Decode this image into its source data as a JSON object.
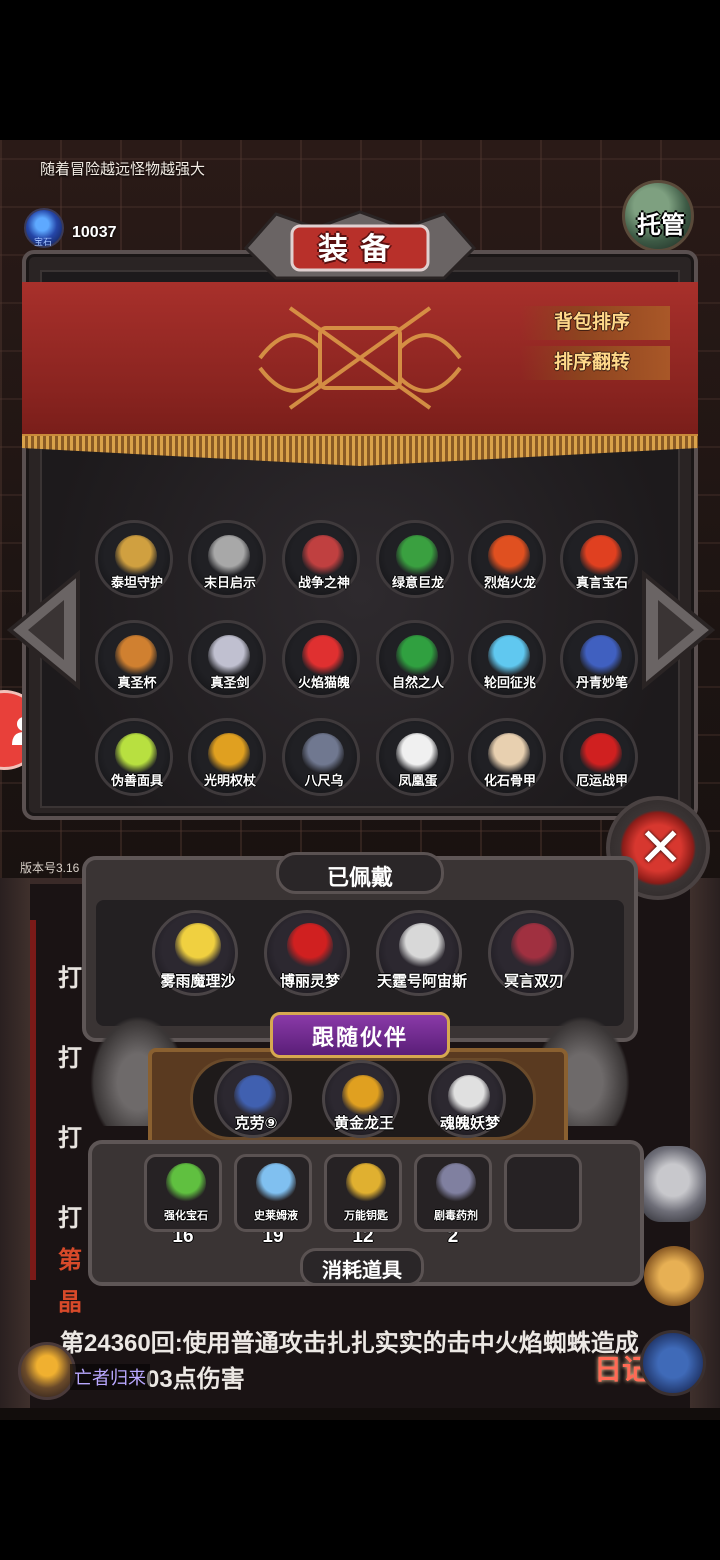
{
  "hint": "随着冒险越远怪物越强大",
  "currency": {
    "label": "宝石",
    "count": "10037",
    "icon": "gem-icon"
  },
  "auto_button": "托管",
  "version": "版本号3.16",
  "equipment": {
    "title": "装备",
    "sort_label": "背包排序",
    "reverse_label": "排序翻转",
    "items": [
      {
        "name": "泰坦守护",
        "color": "#d0a040"
      },
      {
        "name": "末日启示",
        "color": "#a8a8a8"
      },
      {
        "name": "战争之神",
        "color": "#c04040"
      },
      {
        "name": "绿意巨龙",
        "color": "#3aa040"
      },
      {
        "name": "烈焰火龙",
        "color": "#e05020"
      },
      {
        "name": "真言宝石",
        "color": "#e04020"
      },
      {
        "name": "真圣杯",
        "color": "#d08030"
      },
      {
        "name": "真圣剑",
        "color": "#c0c0d0"
      },
      {
        "name": "火焰猫魄",
        "color": "#e03030"
      },
      {
        "name": "自然之人",
        "color": "#30a040"
      },
      {
        "name": "轮回征兆",
        "color": "#60c8f0"
      },
      {
        "name": "丹青妙笔",
        "color": "#4060c0"
      },
      {
        "name": "伪善面具",
        "color": "#b8e040"
      },
      {
        "name": "光明权杖",
        "color": "#e0a020"
      },
      {
        "name": "八尺乌",
        "color": "#707890"
      },
      {
        "name": "凤凰蛋",
        "color": "#f0f0f0"
      },
      {
        "name": "化石骨甲",
        "color": "#e8d0b0"
      },
      {
        "name": "厄运战甲",
        "color": "#d02020"
      }
    ]
  },
  "worn": {
    "title": "已佩戴",
    "chars": [
      {
        "name": "雾雨魔理沙",
        "color": "#f0d040"
      },
      {
        "name": "博丽灵梦",
        "color": "#d02020"
      },
      {
        "name": "天霆号阿宙斯",
        "color": "#d8d8d8"
      },
      {
        "name": "冥言双刃",
        "color": "#a03040"
      }
    ]
  },
  "partners": {
    "title": "跟随伙伴",
    "chars": [
      {
        "name": "克劳⑨",
        "color": "#4060b0"
      },
      {
        "name": "黄金龙王",
        "color": "#e0a020"
      },
      {
        "name": "魂魄妖梦",
        "color": "#e0e0e0"
      }
    ]
  },
  "consumables": {
    "title": "消耗道具",
    "items": [
      {
        "name": "强化宝石",
        "count": "16",
        "color": "#60c040"
      },
      {
        "name": "史莱姆液",
        "count": "19",
        "color": "#80c0f0"
      },
      {
        "name": "万能钥匙",
        "count": "12",
        "color": "#e0b030"
      },
      {
        "name": "剧毒药剂",
        "count": "2",
        "color": "#8080a0"
      }
    ]
  },
  "log": {
    "lines": [
      "打",
      "打",
      "打",
      "打"
    ],
    "partial_red": "第",
    "partial_red2": "晶",
    "entry": "第24360回:使用普通攻击扎扎实实的击中火焰蜘蛛造成",
    "entry2": "03点伤害",
    "hero_status": "亡者归来",
    "diary": "日记"
  }
}
